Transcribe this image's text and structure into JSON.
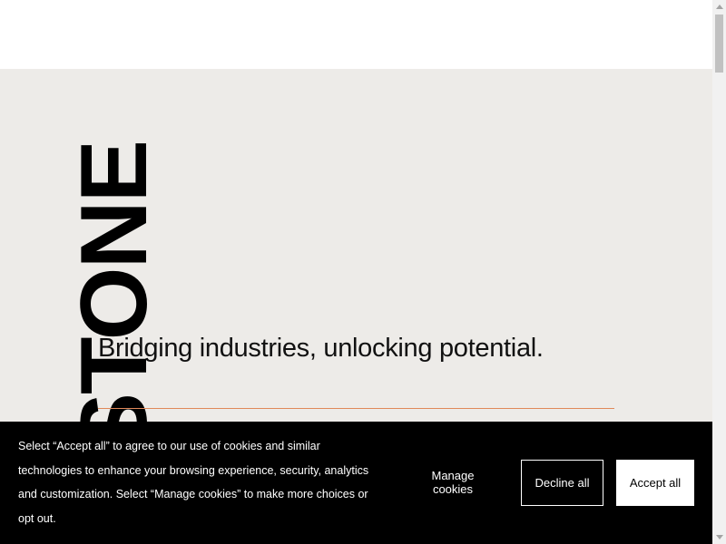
{
  "hero": {
    "brand_text": "STONE",
    "tagline": "Bridging industries, unlocking potential."
  },
  "cookie_banner": {
    "message": "Select “Accept all” to agree to our use of cookies and similar technologies to enhance your browsing experience, security, analytics and customization. Select “Manage cookies” to make more choices or opt out.",
    "manage_label": "Manage cookies",
    "decline_label": "Decline all",
    "accept_label": "Accept all"
  },
  "colors": {
    "hero_background": "#edebe8",
    "accent_rule": "#e0895a",
    "banner_background": "#000000"
  },
  "icons": {
    "scroll_up": "triangle-up-icon",
    "scroll_down": "triangle-down-icon"
  }
}
